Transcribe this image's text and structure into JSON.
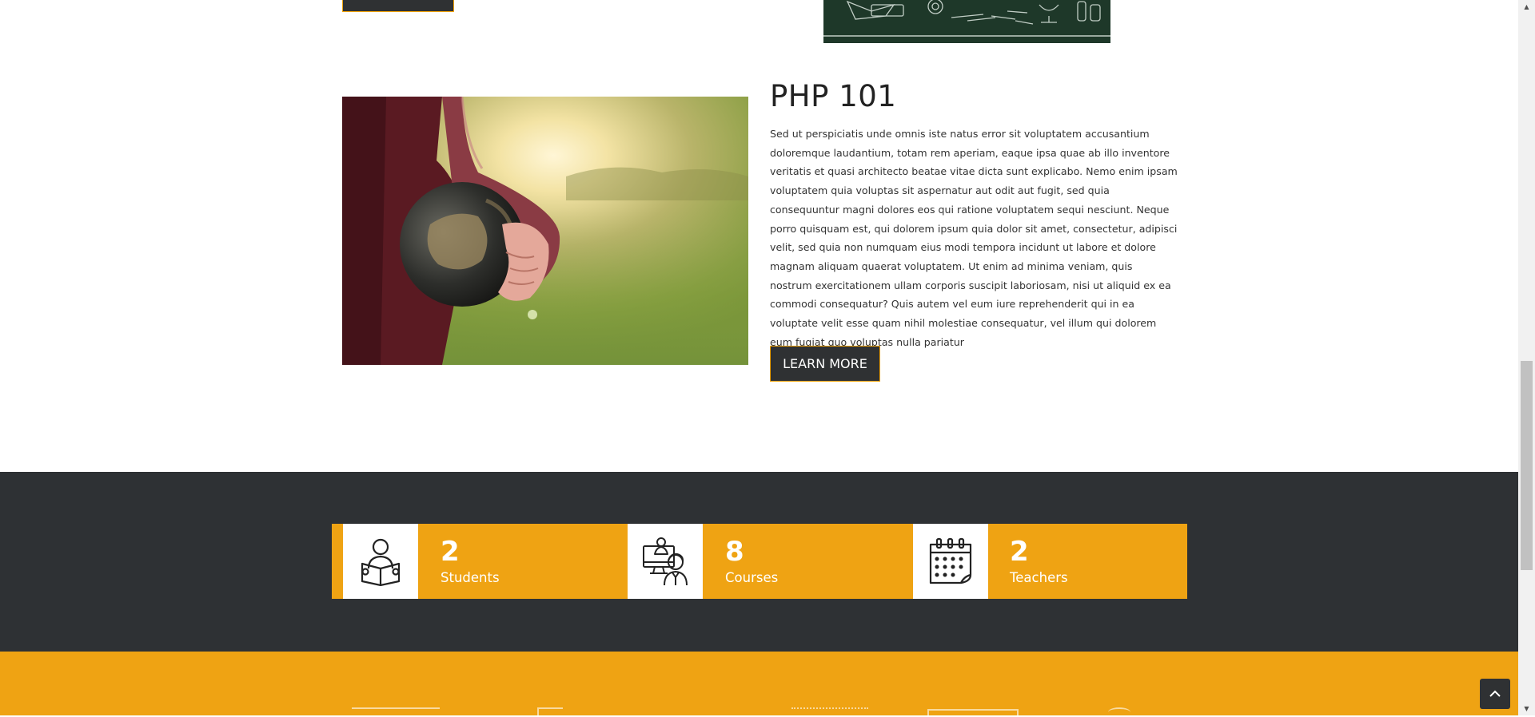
{
  "course": {
    "title": "PHP 101",
    "description": "Sed ut perspiciatis unde omnis iste natus error sit voluptatem accusantium doloremque laudantium, totam rem aperiam, eaque ipsa quae ab illo inventore veritatis et quasi architecto beatae vitae dicta sunt explicabo. Nemo enim ipsam voluptatem quia voluptas sit aspernatur aut odit aut fugit, sed quia consequuntur magni dolores eos qui ratione voluptatem sequi nesciunt. Neque porro quisquam est, qui dolorem ipsum quia dolor sit amet, consectetur, adipisci velit, sed quia non numquam eius modi tempora incidunt ut labore et dolore magnam aliquam quaerat voluptatem. Ut enim ad minima veniam, quis nostrum exercitationem ullam corporis suscipit laboriosam, nisi ut aliquid ex ea commodi consequatur? Quis autem vel eum iure reprehenderit qui in ea voluptate velit esse quam nihil molestiae consequatur, vel illum qui dolorem eum fugiat quo voluptas nulla pariatur",
    "button_label": "LEARN MORE",
    "image_icon": "globe-photo"
  },
  "stats": [
    {
      "number": "2",
      "label": "Students",
      "icon": "student-reading-icon"
    },
    {
      "number": "8",
      "label": "Courses",
      "icon": "online-teacher-icon"
    },
    {
      "number": "2",
      "label": "Teachers",
      "icon": "calendar-icon"
    }
  ],
  "colors": {
    "accent": "#efa313",
    "dark": "#2e3134",
    "button": "#2f3133"
  }
}
